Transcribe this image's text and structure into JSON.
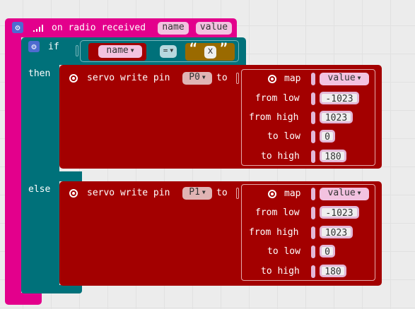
{
  "colors": {
    "radio_block": "#e3008c",
    "logic_block": "#00717a",
    "servo_block": "#a30000",
    "math_block": "#7b2b8e",
    "text_block": "#9a6a00",
    "workspace_bg": "#ececec"
  },
  "event": {
    "label": "on radio received",
    "params": [
      "name",
      "value"
    ]
  },
  "if_block": {
    "if_label": "if",
    "then_label": "then",
    "else_label": "else",
    "condition": {
      "left": "name",
      "operator": "=",
      "right_open_quote": "“",
      "right_value": "x",
      "right_close_quote": "”"
    }
  },
  "servo_then": {
    "write_label": "servo write pin",
    "pin": "P0",
    "to_label": "to",
    "map": {
      "label": "map",
      "value_var": "value",
      "rows": [
        {
          "label": "from low",
          "value": "-1023"
        },
        {
          "label": "from high",
          "value": "1023"
        },
        {
          "label": "to low",
          "value": "0"
        },
        {
          "label": "to high",
          "value": "180"
        }
      ]
    }
  },
  "servo_else": {
    "write_label": "servo write pin",
    "pin": "P1",
    "to_label": "to",
    "map": {
      "label": "map",
      "value_var": "value",
      "rows": [
        {
          "label": "from low",
          "value": "-1023"
        },
        {
          "label": "from high",
          "value": "1023"
        },
        {
          "label": "to low",
          "value": "0"
        },
        {
          "label": "to high",
          "value": "180"
        }
      ]
    }
  },
  "icons": {
    "gear": "gear-icon",
    "signal": "radio-signal-icon",
    "servo": "servo-target-icon",
    "dropdown": "chevron-down-icon"
  }
}
